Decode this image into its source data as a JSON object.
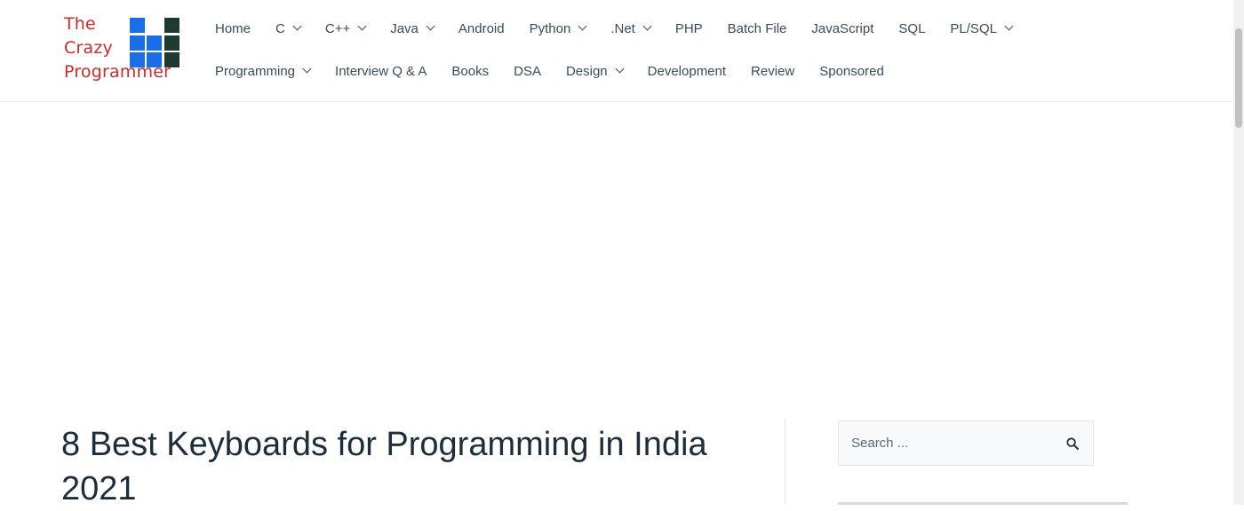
{
  "logo": {
    "lines": [
      "The",
      "Crazy",
      "Programmer"
    ],
    "colors": {
      "text": "#cc2b2b",
      "blue": "#1a6ee8",
      "dark": "#1f3a2e"
    }
  },
  "nav": {
    "row1": [
      {
        "label": "Home",
        "dropdown": false
      },
      {
        "label": "C",
        "dropdown": true
      },
      {
        "label": "C++",
        "dropdown": true
      },
      {
        "label": "Java",
        "dropdown": true
      },
      {
        "label": "Android",
        "dropdown": false
      },
      {
        "label": "Python",
        "dropdown": true
      },
      {
        "label": ".Net",
        "dropdown": true
      },
      {
        "label": "PHP",
        "dropdown": false
      },
      {
        "label": "Batch File",
        "dropdown": false
      },
      {
        "label": "JavaScript",
        "dropdown": false
      },
      {
        "label": "SQL",
        "dropdown": false
      },
      {
        "label": "PL/SQL",
        "dropdown": true
      }
    ],
    "row2": [
      {
        "label": "Programming",
        "dropdown": true
      },
      {
        "label": "Interview Q & A",
        "dropdown": false
      },
      {
        "label": "Books",
        "dropdown": false
      },
      {
        "label": "DSA",
        "dropdown": false
      },
      {
        "label": "Design",
        "dropdown": true
      },
      {
        "label": "Development",
        "dropdown": false
      },
      {
        "label": "Review",
        "dropdown": false
      },
      {
        "label": "Sponsored",
        "dropdown": false
      }
    ]
  },
  "post": {
    "title": "8 Best Keyboards for Programming in India 2021"
  },
  "sidebar": {
    "search": {
      "placeholder": "Search ...",
      "icon": "search-icon"
    }
  }
}
